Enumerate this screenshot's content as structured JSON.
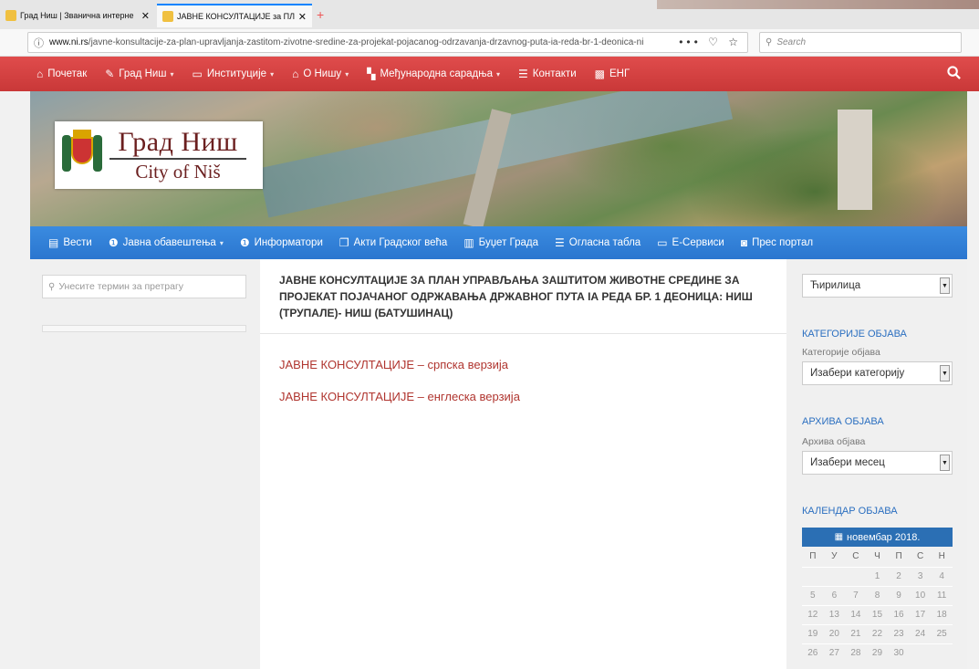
{
  "browser": {
    "tabs": [
      {
        "title": "Град Ниш | Званична интерне",
        "close": "✕"
      },
      {
        "title": "ЈАВНЕ КОНСУЛТАЦИЈЕ за ПЛ",
        "close": "✕"
      }
    ],
    "new_tab": "+",
    "url_domain": "www.ni.rs",
    "url_path": "/javne-konsultacije-za-plan-upravljanja-zastitom-zivotne-sredine-za-projekat-pojacanog-odrzavanja-drzavnog-puta-ia-reda-br-1-deonica-ni",
    "url_actions": "••• ♡ ☆",
    "search_placeholder": "Search"
  },
  "top_nav": {
    "items": [
      {
        "icon": "home-icon",
        "glyph": "⌂",
        "label": "Почетак",
        "dropdown": false
      },
      {
        "icon": "wrench-icon",
        "glyph": "✎",
        "label": "Град Ниш",
        "dropdown": true
      },
      {
        "icon": "briefcase-icon",
        "glyph": "▭",
        "label": "Институције",
        "dropdown": true
      },
      {
        "icon": "bank-icon",
        "glyph": "⌂",
        "label": "О Нишу",
        "dropdown": true
      },
      {
        "icon": "handshake-icon",
        "glyph": "▚",
        "label": "Међународна сарадња",
        "dropdown": true
      },
      {
        "icon": "list-icon",
        "glyph": "☰",
        "label": "Контакти",
        "dropdown": false
      },
      {
        "icon": "flag-icon",
        "glyph": "▩",
        "label": "ЕНГ",
        "dropdown": false
      }
    ],
    "search_glyph": "🔍"
  },
  "logo": {
    "line1": "Град Ниш",
    "line2": "City of Niš"
  },
  "second_nav": {
    "items": [
      {
        "icon": "newspaper-icon",
        "glyph": "▤",
        "label": "Вести",
        "dropdown": false
      },
      {
        "icon": "info-circle-icon",
        "glyph": "❶",
        "label": "Јавна обавештења",
        "dropdown": true
      },
      {
        "icon": "info-icon",
        "glyph": "❶",
        "label": "Информатори",
        "dropdown": false
      },
      {
        "icon": "copy-icon",
        "glyph": "❐",
        "label": "Акти Градског већа",
        "dropdown": false
      },
      {
        "icon": "bar-chart-icon",
        "glyph": "▥",
        "label": "Буџет Града",
        "dropdown": false
      },
      {
        "icon": "list-icon",
        "glyph": "☰",
        "label": "Огласна табла",
        "dropdown": false
      },
      {
        "icon": "laptop-icon",
        "glyph": "▭",
        "label": "Е-Сервиси",
        "dropdown": false
      },
      {
        "icon": "camera-icon",
        "glyph": "◙",
        "label": "Прес портал",
        "dropdown": false
      }
    ]
  },
  "left_sidebar": {
    "search_placeholder": "Унесите термин за претрагу"
  },
  "main": {
    "title": "ЈАВНЕ КОНСУЛТАЦИЈЕ ЗА ПЛАН УПРАВЉАЊА ЗАШТИТОМ ЖИВОТНЕ СРЕДИНЕ ЗА ПРОЈЕКАТ ПОЈАЧАНОГ ОДРЖАВАЊА ДРЖАВНОГ ПУТА IА РЕДА БР. 1 ДЕОНИЦА: НИШ (ТРУПАЛЕ)- НИШ (БАТУШИНАЦ)",
    "links": [
      "ЈАВНЕ КОНСУЛТАЦИЈЕ – српска верзија",
      "ЈАВНЕ КОНСУЛТАЦИЈЕ – енглеска верзија"
    ]
  },
  "right_sidebar": {
    "script_select": "Ћирилица",
    "categories_heading": "КАТЕГОРИЈЕ ОБЈАВА",
    "categories_label": "Категорије објава",
    "categories_select": "Изабери категорију",
    "archive_heading": "АРХИВА ОБЈАВА",
    "archive_label": "Архива објава",
    "archive_select": "Изабери месец",
    "calendar_heading": "КАЛЕНДАР ОБЈАВА",
    "calendar": {
      "month": "новембар 2018.",
      "weekdays": [
        "П",
        "У",
        "С",
        "Ч",
        "П",
        "С",
        "Н"
      ],
      "weeks": [
        [
          "",
          "",
          "",
          "1",
          "2",
          "3",
          "4"
        ],
        [
          "5",
          "6",
          "7",
          "8",
          "9",
          "10",
          "11"
        ],
        [
          "12",
          "13",
          "14",
          "15",
          "16",
          "17",
          "18"
        ],
        [
          "19",
          "20",
          "21",
          "22",
          "23",
          "24",
          "25"
        ],
        [
          "26",
          "27",
          "28",
          "29",
          "30",
          "",
          ""
        ]
      ]
    }
  },
  "colors": {
    "red_nav": "#d64242",
    "blue_nav": "#3380d8",
    "link": "#b0352f",
    "heading_blue": "#2b6fc0"
  }
}
